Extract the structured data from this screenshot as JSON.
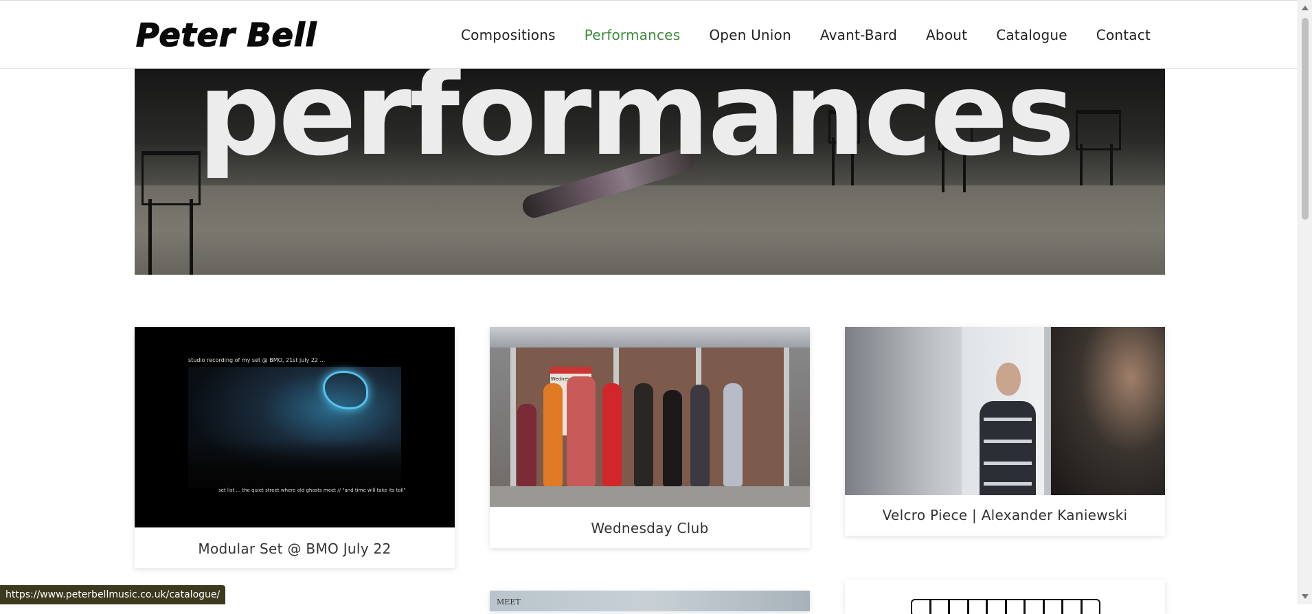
{
  "header": {
    "logo": "Peter Bell",
    "nav": [
      {
        "label": "Compositions"
      },
      {
        "label": "Performances"
      },
      {
        "label": "Open Union"
      },
      {
        "label": "Avant-Bard"
      },
      {
        "label": "About"
      },
      {
        "label": "Catalogue"
      },
      {
        "label": "Contact"
      }
    ],
    "active_nav": "Performances",
    "accent_color": "#3d8b3d"
  },
  "hero": {
    "heading": "performances"
  },
  "cards": [
    {
      "title": "Modular Set @ BMO July 22",
      "image_caption_top": "studio recording of my set @ BMO, 21st july 22 ...",
      "image_caption_bottom": "set list ...   the quiet street where old ghosts meet // \"and time will take its toll\""
    },
    {
      "title": "Wednesday Club",
      "image_sign": "Wednesday Club"
    },
    {
      "title": "Velcro Piece | Alexander Kaniewski"
    },
    {
      "image_text": "MEET"
    }
  ],
  "status_bar": {
    "url": "https://www.peterbellmusic.co.uk/catalogue/"
  }
}
